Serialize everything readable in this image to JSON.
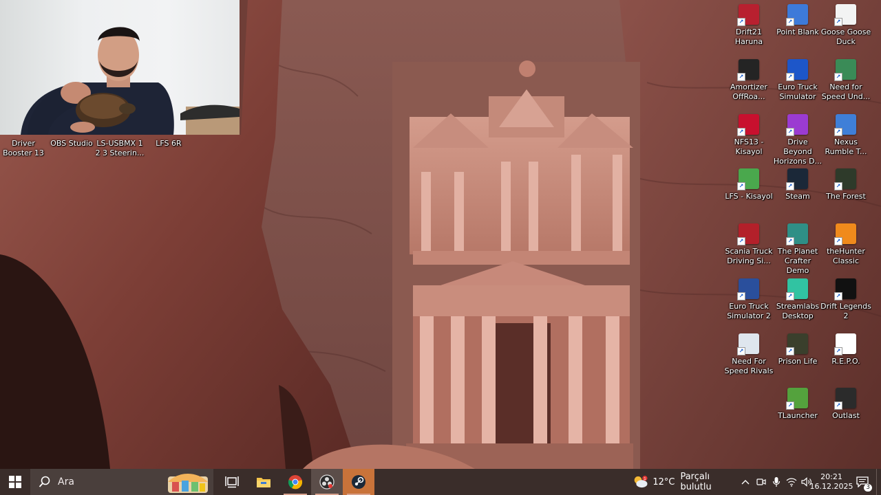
{
  "desktop": {
    "top_row_icons": [
      {
        "label": "Driver Booster 13",
        "icon": "driver-booster-icon",
        "color": "#e53935"
      },
      {
        "label": "OBS Studio",
        "icon": "obs-icon",
        "color": "#302e31"
      },
      {
        "label": "LS-USBMX 1 2 3 Steerin...",
        "icon": "steering-icon",
        "color": "#1e2b4a"
      },
      {
        "label": "LFS 6R",
        "icon": "lfs-icon",
        "color": "#2a6fb5"
      }
    ],
    "right_icons": [
      {
        "label": "Drift21 Haruna",
        "icon": "drift21-icon",
        "color": "#b8202f"
      },
      {
        "label": "Point Blank",
        "icon": "point-blank-icon",
        "color": "#3d7ad9"
      },
      {
        "label": "Goose Goose Duck",
        "icon": "goose-icon",
        "color": "#f3f3f3"
      },
      {
        "label": "Amortizer OffRoa...",
        "icon": "amortizer-icon",
        "color": "#242424"
      },
      {
        "label": "Euro Truck Simulator",
        "icon": "ets-icon",
        "color": "#1d56c9"
      },
      {
        "label": "Need for Speed Und...",
        "icon": "nfs-underground-icon",
        "color": "#3a8b57"
      },
      {
        "label": "NFS13 - Kisayol",
        "icon": "nfs13-icon",
        "color": "#c8102e"
      },
      {
        "label": "Drive Beyond Horizons D...",
        "icon": "drive-beyond-icon",
        "color": "#9b3bd1"
      },
      {
        "label": "Nexus Rumble T...",
        "icon": "nexus-icon",
        "color": "#3f7fd8"
      },
      {
        "label": "LFS - Kisayol",
        "icon": "lfs-shortcut-icon",
        "color": "#4aa84d"
      },
      {
        "label": "Steam",
        "icon": "steam-icon",
        "color": "#1b2838"
      },
      {
        "label": "The Forest",
        "icon": "forest-icon",
        "color": "#2e3a2a"
      },
      {
        "label": "Scania Truck Driving Si...",
        "icon": "scania-icon",
        "color": "#b3202a"
      },
      {
        "label": "The Planet Crafter Demo",
        "icon": "planet-crafter-icon",
        "color": "#2f8f86"
      },
      {
        "label": "theHunter Classic",
        "icon": "hunter-icon",
        "color": "#f08a1c"
      },
      {
        "label": "Euro Truck Simulator 2",
        "icon": "ets2-icon",
        "color": "#2a4f9c"
      },
      {
        "label": "Streamlabs Desktop",
        "icon": "streamlabs-icon",
        "color": "#31c3a2"
      },
      {
        "label": "Drift Legends 2",
        "icon": "drift-legends-icon",
        "color": "#111111"
      },
      {
        "label": "Need For Speed Rivals",
        "icon": "nfs-rivals-icon",
        "color": "#dfe6ee"
      },
      {
        "label": "Prison Life",
        "icon": "prison-life-icon",
        "color": "#3a3f2c"
      },
      {
        "label": "R.E.P.O.",
        "icon": "file-icon",
        "color": "#ffffff"
      },
      {
        "label": "",
        "icon": "none",
        "color": ""
      },
      {
        "label": "TLauncher",
        "icon": "tlauncher-icon",
        "color": "#54a23d"
      },
      {
        "label": "Outlast",
        "icon": "outlast-icon",
        "color": "#2b2b2b"
      }
    ]
  },
  "taskbar": {
    "search_placeholder": "Ara",
    "apps": [
      {
        "name": "task-view",
        "icon": "task-view-icon"
      },
      {
        "name": "file-explorer",
        "icon": "folder-icon"
      },
      {
        "name": "chrome",
        "icon": "chrome-icon"
      },
      {
        "name": "obs",
        "icon": "obs-icon"
      },
      {
        "name": "steam",
        "icon": "steam-icon"
      }
    ],
    "weather": {
      "temperature": "12°C",
      "condition": "Parçalı bulutlu"
    },
    "clock": {
      "time": "20:21",
      "date": "16.12.2025"
    },
    "notifications_count": "3"
  }
}
